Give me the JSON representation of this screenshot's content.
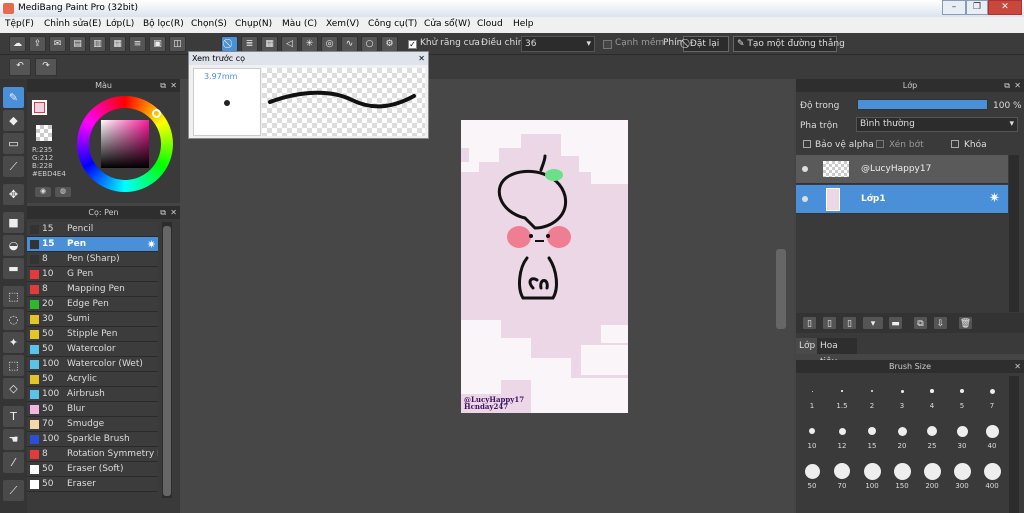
{
  "window": {
    "title": "MediBang Paint Pro (32bit)"
  },
  "menu": [
    "Tệp(F)",
    "Chỉnh sửa(E)",
    "Lớp(L)",
    "Bộ lọc(R)",
    "Chọn(S)",
    "Chụp(N)",
    "Màu (C)",
    "Xem(V)",
    "Công cụ(T)",
    "Cửa sổ(W)",
    "Cloud",
    "Help"
  ],
  "toolbar": {
    "antialias_label": "Khử răng cưa",
    "adjust_label": "Điều chỉnh",
    "adjust_value": "36",
    "edge_label": "Cạnh mềm",
    "phim_label": "Phím",
    "reset_label": "Đặt lại",
    "line_label": "Tạo một đường thẳng"
  },
  "color_panel": {
    "title": "Màu",
    "r": "R:235",
    "g": "G:212",
    "b": "B:228",
    "hex": "#EBD4E4",
    "accent": "#EBD4E4"
  },
  "brush_preview": {
    "title": "Xem trước cọ",
    "size": "3.97mm"
  },
  "brush_panel": {
    "title": "Cọ: Pen",
    "items": [
      {
        "n": "15",
        "label": "Pencil",
        "color": "#333333"
      },
      {
        "n": "15",
        "label": "Pen",
        "color": "#333333"
      },
      {
        "n": "8",
        "label": "Pen (Sharp)",
        "color": "#333333"
      },
      {
        "n": "10",
        "label": "G Pen",
        "color": "#e23b3b"
      },
      {
        "n": "8",
        "label": "Mapping Pen",
        "color": "#e23b3b"
      },
      {
        "n": "20",
        "label": "Edge Pen",
        "color": "#2db82d"
      },
      {
        "n": "30",
        "label": "Sumi",
        "color": "#e2c42b"
      },
      {
        "n": "50",
        "label": "Stipple Pen",
        "color": "#e2c42b"
      },
      {
        "n": "50",
        "label": "Watercolor",
        "color": "#5bc3e8"
      },
      {
        "n": "100",
        "label": "Watercolor (Wet)",
        "color": "#5bc3e8"
      },
      {
        "n": "50",
        "label": "Acrylic",
        "color": "#e2c42b"
      },
      {
        "n": "100",
        "label": "Airbrush",
        "color": "#5bc3e8"
      },
      {
        "n": "50",
        "label": "Blur",
        "color": "#f0b8e0"
      },
      {
        "n": "70",
        "label": "Smudge",
        "color": "#f5d7a8"
      },
      {
        "n": "100",
        "label": "Sparkle Brush",
        "color": "#2d4fd8"
      },
      {
        "n": "8",
        "label": "Rotation Symmetry Pe",
        "color": "#e23b3b"
      },
      {
        "n": "50",
        "label": "Eraser (Soft)",
        "color": "#ffffff"
      },
      {
        "n": "50",
        "label": "Eraser",
        "color": "#ffffff"
      }
    ]
  },
  "canvas": {
    "watermark1": "@LucyHappy17",
    "watermark2": "Hcnday247",
    "background": "#ECD7E6"
  },
  "layer_panel": {
    "title": "Lớp",
    "opacity_label": "Độ trong",
    "opacity_value": "100 %",
    "blend_label": "Pha trộn",
    "blend_value": "Bình thường",
    "protect_alpha": "Bảo vệ alpha",
    "clipping": "Xén bớt",
    "lock": "Khóa",
    "layers": [
      {
        "name": "@LucyHappy17"
      },
      {
        "name": "Lớp1"
      }
    ],
    "tab_layer": "Lớp",
    "tab_navigator": "Hoa tiêu"
  },
  "brush_size_panel": {
    "title": "Brush Size",
    "sizes": [
      "1",
      "1.5",
      "2",
      "3",
      "4",
      "5",
      "7",
      "10",
      "12",
      "15",
      "20",
      "25",
      "30",
      "40",
      "50",
      "70",
      "100",
      "150",
      "200",
      "300",
      "400"
    ]
  }
}
